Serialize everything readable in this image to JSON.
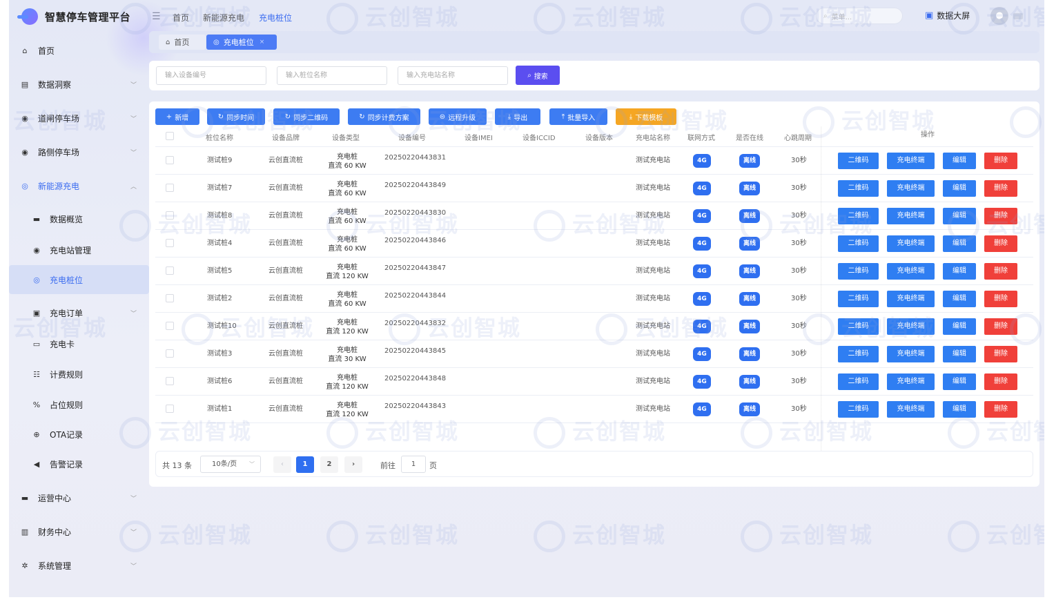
{
  "app": {
    "title": "智慧停车管理平台"
  },
  "topbar": {
    "breadcrumbs": [
      "首页",
      "新能源充电",
      "充电桩位"
    ],
    "search_placeholder": "菜单...",
    "bigscreen_label": "数据大屏"
  },
  "sidebar": {
    "items": [
      {
        "label": "首页",
        "icon": "home-icon"
      },
      {
        "label": "数据洞察",
        "icon": "chart-icon"
      },
      {
        "label": "道闸停车场",
        "icon": "location-icon"
      },
      {
        "label": "路侧停车场",
        "icon": "location-icon"
      },
      {
        "label": "新能源充电",
        "icon": "charge-icon"
      },
      {
        "label": "数据概览",
        "icon": "monitor-icon"
      },
      {
        "label": "充电站管理",
        "icon": "location-icon"
      },
      {
        "label": "充电桩位",
        "icon": "charge-icon"
      },
      {
        "label": "充电订单",
        "icon": "order-icon"
      },
      {
        "label": "充电卡",
        "icon": "card-icon"
      },
      {
        "label": "计费规则",
        "icon": "rule-icon"
      },
      {
        "label": "占位规则",
        "icon": "tag-icon"
      },
      {
        "label": "OTA记录",
        "icon": "ota-icon"
      },
      {
        "label": "告警记录",
        "icon": "alarm-icon"
      },
      {
        "label": "运营中心",
        "icon": "operate-icon"
      },
      {
        "label": "财务中心",
        "icon": "finance-icon"
      },
      {
        "label": "系统管理",
        "icon": "settings-icon"
      }
    ]
  },
  "tabs": [
    {
      "label": "首页"
    },
    {
      "label": "充电桩位"
    }
  ],
  "search": {
    "device_no_placeholder": "输入设备编号",
    "pile_name_placeholder": "输入桩位名称",
    "station_name_placeholder": "输入充电站名称",
    "search_button": "搜索"
  },
  "toolbar": {
    "add": "新增",
    "sync_time": "同步时间",
    "sync_qr": "同步二维码",
    "sync_fee": "同步计费方案",
    "remote_upgrade": "远程升级",
    "export": "导出",
    "batch_import": "批量导入",
    "download_template": "下载模板"
  },
  "table": {
    "headers": [
      "桩位名称",
      "设备品牌",
      "设备类型",
      "设备编号",
      "设备IMEI",
      "设备ICCID",
      "设备版本",
      "充电站名称",
      "联网方式",
      "是否在线",
      "心跳周期",
      "操作"
    ],
    "rows": [
      {
        "name": "测试桩9",
        "brand": "云创直流桩",
        "type1": "充电桩",
        "type2": "直流 60 KW",
        "code": "20250220443831",
        "station": "测试充电站",
        "net": "4G",
        "online": "离线",
        "heartbeat": "30秒"
      },
      {
        "name": "测试桩7",
        "brand": "云创直流桩",
        "type1": "充电桩",
        "type2": "直流 60 KW",
        "code": "20250220443849",
        "station": "测试充电站",
        "net": "4G",
        "online": "离线",
        "heartbeat": "30秒"
      },
      {
        "name": "测试桩8",
        "brand": "云创直流桩",
        "type1": "充电桩",
        "type2": "直流 60 KW",
        "code": "20250220443830",
        "station": "测试充电站",
        "net": "4G",
        "online": "离线",
        "heartbeat": "30秒"
      },
      {
        "name": "测试桩4",
        "brand": "云创直流桩",
        "type1": "充电桩",
        "type2": "直流 60 KW",
        "code": "20250220443846",
        "station": "测试充电站",
        "net": "4G",
        "online": "离线",
        "heartbeat": "30秒"
      },
      {
        "name": "测试桩5",
        "brand": "云创直流桩",
        "type1": "充电桩",
        "type2": "直流 120 KW",
        "code": "20250220443847",
        "station": "测试充电站",
        "net": "4G",
        "online": "离线",
        "heartbeat": "30秒"
      },
      {
        "name": "测试桩2",
        "brand": "云创直流桩",
        "type1": "充电桩",
        "type2": "直流 60 KW",
        "code": "20250220443844",
        "station": "测试充电站",
        "net": "4G",
        "online": "离线",
        "heartbeat": "30秒"
      },
      {
        "name": "测试桩10",
        "brand": "云创直流桩",
        "type1": "充电桩",
        "type2": "直流 120 KW",
        "code": "20250220443832",
        "station": "测试充电站",
        "net": "4G",
        "online": "离线",
        "heartbeat": "30秒"
      },
      {
        "name": "测试桩3",
        "brand": "云创直流桩",
        "type1": "充电桩",
        "type2": "直流 30 KW",
        "code": "20250220443845",
        "station": "测试充电站",
        "net": "4G",
        "online": "离线",
        "heartbeat": "30秒"
      },
      {
        "name": "测试桩6",
        "brand": "云创直流桩",
        "type1": "充电桩",
        "type2": "直流 120 KW",
        "code": "20250220443848",
        "station": "测试充电站",
        "net": "4G",
        "online": "离线",
        "heartbeat": "30秒"
      },
      {
        "name": "测试桩1",
        "brand": "云创直流桩",
        "type1": "充电桩",
        "type2": "直流 120 KW",
        "code": "20250220443843",
        "station": "测试充电站",
        "net": "4G",
        "online": "离线",
        "heartbeat": "30秒"
      }
    ],
    "actions": [
      "二维码",
      "充电终端",
      "编辑",
      "删除"
    ]
  },
  "pagination": {
    "total": "共 13 条",
    "page_size": "10条/页",
    "pages": [
      "1",
      "2"
    ],
    "jump_label": "前往",
    "jump_value": "1",
    "jump_unit": "页"
  },
  "watermark": "云创智城",
  "colors": {
    "primary": "#2f6ff0",
    "danger": "#f0403a",
    "warning": "#f5a623",
    "search": "#5b4ef0"
  }
}
